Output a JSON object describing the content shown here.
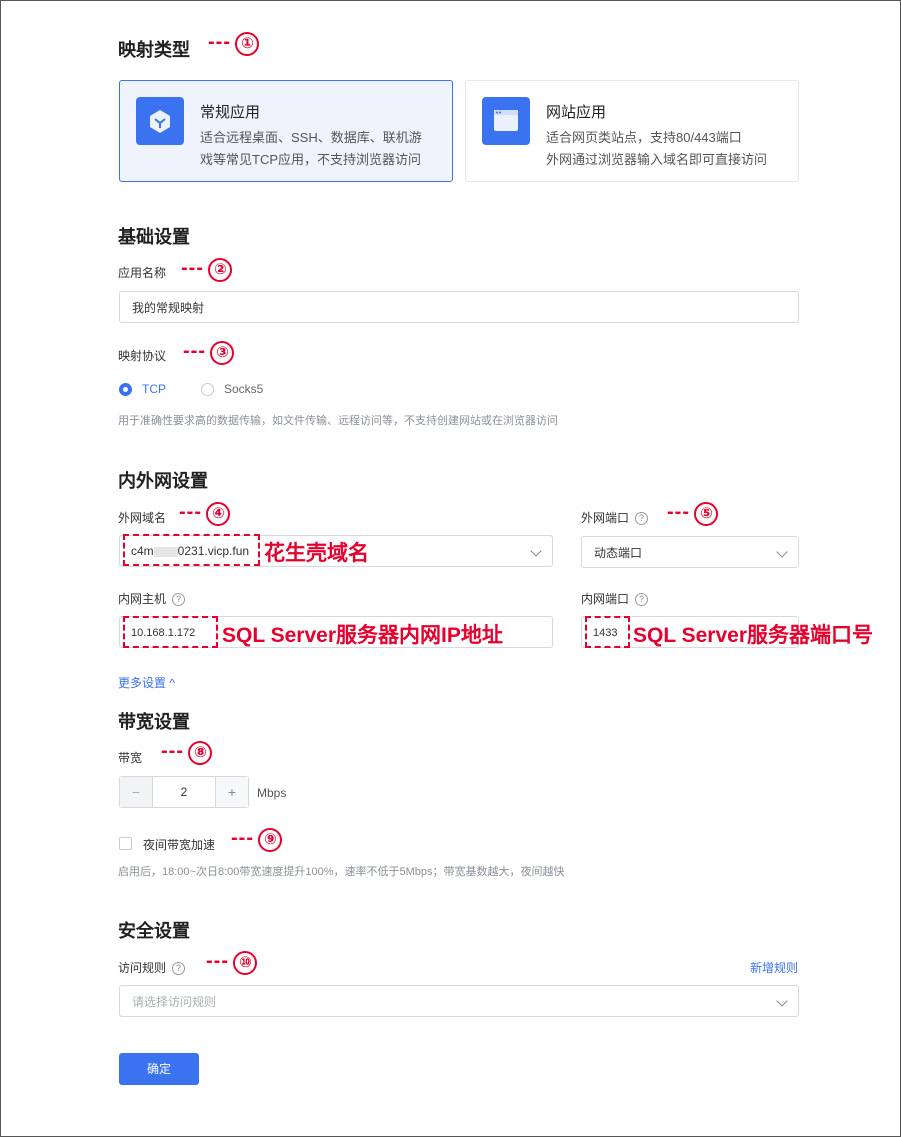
{
  "mapping_type": {
    "title": "映射类型",
    "annotation": "---",
    "num": "①",
    "cards": [
      {
        "title": "常规应用",
        "desc1": "适合远程桌面、SSH、数据库、联机游",
        "desc2": "戏等常见TCP应用，不支持浏览器访问",
        "selected": true,
        "icon": "cube-icon"
      },
      {
        "title": "网站应用",
        "desc1": "适合网页类站点，支持80/443端口",
        "desc2": "外网通过浏览器输入域名即可直接访问",
        "selected": false,
        "icon": "browser-window-icon"
      }
    ]
  },
  "basic": {
    "title": "基础设置",
    "app_name_label": "应用名称",
    "app_name_num": "②",
    "app_name_value": "我的常规映射",
    "protocol_label": "映射协议",
    "protocol_num": "③",
    "options": [
      "TCP",
      "Socks5"
    ],
    "selected": "TCP",
    "protocol_hint": "用于准确性要求高的数据传输，如文件传输、远程访问等，不支持创建网站或在浏览器访问"
  },
  "network": {
    "title": "内外网设置",
    "ext_domain_label": "外网域名",
    "ext_domain_num": "④",
    "ext_domain_value_a": "c4m",
    "ext_domain_value_b": "0231.vicp.fun",
    "ext_domain_note": "花生壳域名",
    "ext_port_label": "外网端口",
    "ext_port_num": "⑤",
    "ext_port_value": "动态端口",
    "int_host_label": "内网主机",
    "int_host_value": "10.168.1.172",
    "int_host_note": "SQL Server服务器内网IP地址",
    "int_port_label": "内网端口",
    "int_port_value": "1433",
    "int_port_note": "SQL Server服务器端口号",
    "more": "更多设置 ^"
  },
  "bandwidth": {
    "title": "带宽设置",
    "label": "带宽",
    "num": "⑧",
    "minus": "−",
    "value": "2",
    "plus": "+",
    "unit": "Mbps",
    "night_label": "夜间带宽加速",
    "night_num": "⑨",
    "night_checked": false,
    "night_hint": "启用后，18:00~次日8:00带宽速度提升100%，速率不低于5Mbps；带宽基数越大，夜间越快"
  },
  "security": {
    "title": "安全设置",
    "rule_label": "访问规则",
    "rule_num": "⑩",
    "add_rule": "新增规则",
    "rule_placeholder": "请选择访问规则"
  },
  "submit": "确定",
  "colors": {
    "accent": "#3a72f0",
    "annotation": "#e6002d"
  }
}
